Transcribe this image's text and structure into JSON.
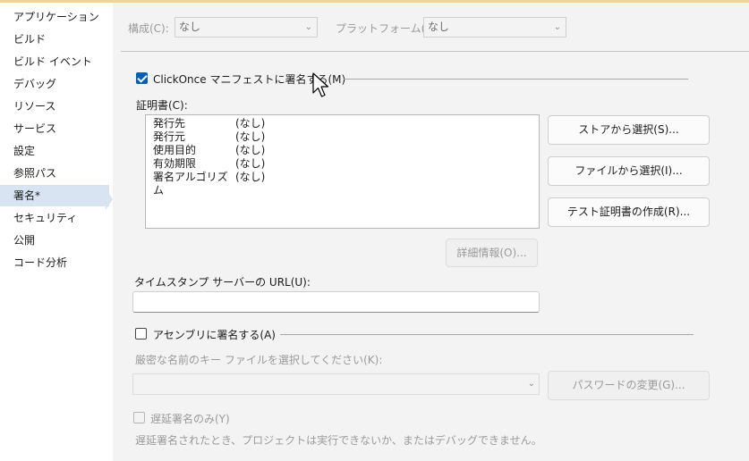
{
  "sidebar": {
    "items": [
      {
        "label": "アプリケーション"
      },
      {
        "label": "ビルド"
      },
      {
        "label": "ビルド イベント"
      },
      {
        "label": "デバッグ"
      },
      {
        "label": "リソース"
      },
      {
        "label": "サービス"
      },
      {
        "label": "設定"
      },
      {
        "label": "参照パス"
      },
      {
        "label": "署名*"
      },
      {
        "label": "セキュリティ"
      },
      {
        "label": "公開"
      },
      {
        "label": "コード分析"
      }
    ],
    "active_index": 8
  },
  "config": {
    "configuration_label": "構成(C):",
    "configuration_value": "なし",
    "platform_label": "プラットフォーム(M):",
    "platform_value": "なし"
  },
  "clickonce": {
    "checkbox_label": "ClickOnce マニフェストに署名する(M)",
    "checked": true,
    "certificate_label": "証明書(C):",
    "certificate_rows": [
      {
        "key": "発行先",
        "value": "(なし)"
      },
      {
        "key": "発行元",
        "value": "(なし)"
      },
      {
        "key": "使用目的",
        "value": "(なし)"
      },
      {
        "key": "有効期限",
        "value": "(なし)"
      },
      {
        "key": "署名アルゴリズム",
        "value": "(なし)"
      }
    ],
    "select_from_store_button": "ストアから選択(S)...",
    "select_from_file_button": "ファイルから選択(I)...",
    "create_test_cert_button": "テスト証明書の作成(R)...",
    "more_details_button": "詳細情報(O)...",
    "timestamp_label": "タイムスタンプ サーバーの URL(U):",
    "timestamp_value": ""
  },
  "assembly": {
    "checkbox_label": "アセンブリに署名する(A)",
    "checked": false,
    "key_file_label": "厳密な名前のキー ファイルを選択してください(K):",
    "key_file_value": "",
    "change_password_button": "パスワードの変更(G)...",
    "delay_sign_label": "遅延署名のみ(Y)",
    "delay_sign_note": "遅延署名されたとき、プロジェクトは実行できないか、またはデバッグできません。"
  },
  "icons": {
    "chevron": "chevron-down-icon",
    "cursor": "mouse-pointer-icon"
  },
  "colors": {
    "accent": "#005fb8",
    "sidebar_active": "#d9e4f2",
    "top_accent": "#f3d29a"
  }
}
